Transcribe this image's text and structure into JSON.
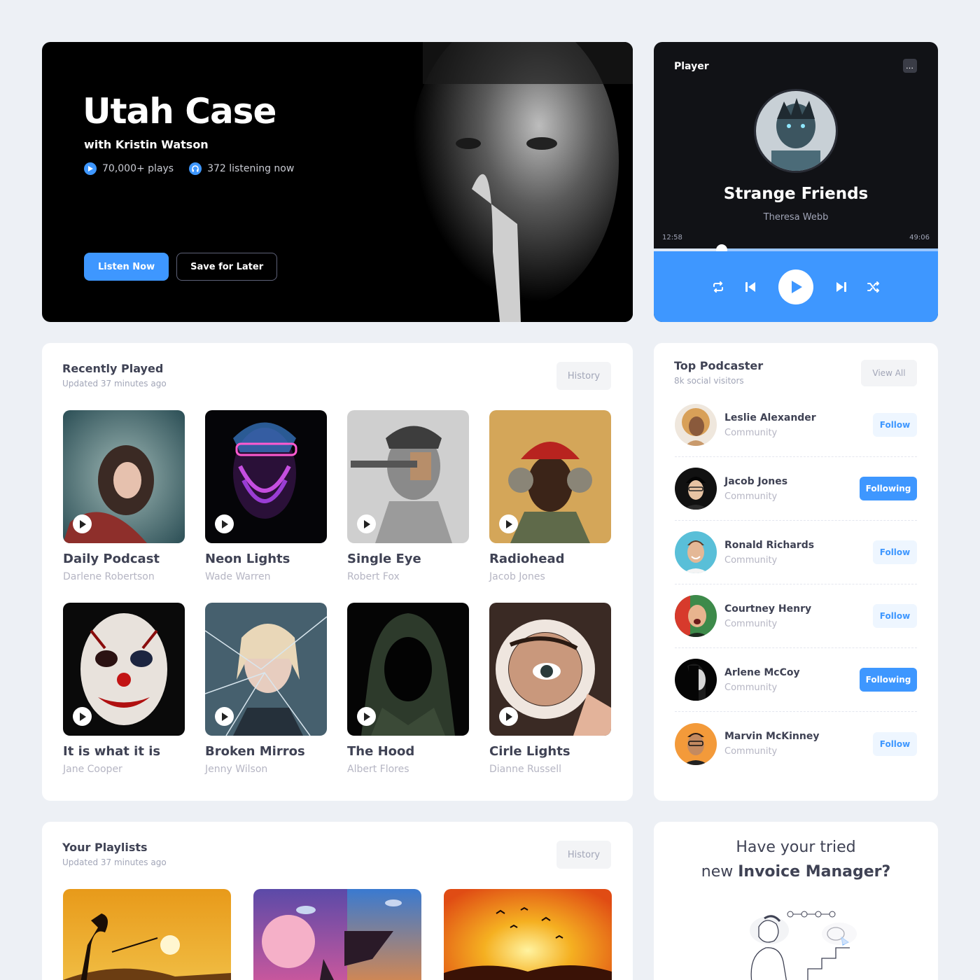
{
  "hero": {
    "title": "Utah Case",
    "subtitle": "with Kristin Watson",
    "plays": "70,000+ plays",
    "listening": "372 listening now",
    "listen_label": "Listen Now",
    "save_label": "Save for Later"
  },
  "player": {
    "label": "Player",
    "menu_icon": "…",
    "song": "Strange Friends",
    "artist": "Theresa Webb",
    "elapsed": "12:58",
    "total": "49:06",
    "progress_fraction": 0.24,
    "accent": "#3E97FF"
  },
  "recent": {
    "title": "Recently Played",
    "subtitle": "Updated 37 minutes ago",
    "history_label": "History",
    "items": [
      {
        "title": "Daily Podcast",
        "artist": "Darlene Robertson"
      },
      {
        "title": "Neon Lights",
        "artist": "Wade Warren"
      },
      {
        "title": "Single Eye",
        "artist": "Robert Fox"
      },
      {
        "title": "Radiohead",
        "artist": "Jacob Jones"
      },
      {
        "title": "It is what it is",
        "artist": "Jane Cooper"
      },
      {
        "title": "Broken Mirros",
        "artist": "Jenny Wilson"
      },
      {
        "title": "The Hood",
        "artist": "Albert Flores"
      },
      {
        "title": "Cirle Lights",
        "artist": "Dianne Russell"
      }
    ]
  },
  "top": {
    "title": "Top Podcaster",
    "subtitle": "8k social visitors",
    "viewall_label": "View All",
    "items": [
      {
        "name": "Leslie Alexander",
        "role": "Community",
        "action": "Follow",
        "following": false
      },
      {
        "name": "Jacob Jones",
        "role": "Community",
        "action": "Following",
        "following": true
      },
      {
        "name": "Ronald Richards",
        "role": "Community",
        "action": "Follow",
        "following": false
      },
      {
        "name": "Courtney Henry",
        "role": "Community",
        "action": "Follow",
        "following": false
      },
      {
        "name": "Arlene McCoy",
        "role": "Community",
        "action": "Following",
        "following": true
      },
      {
        "name": "Marvin McKinney",
        "role": "Community",
        "action": "Follow",
        "following": false
      }
    ]
  },
  "playlists": {
    "title": "Your Playlists",
    "subtitle": "Updated 37 minutes ago",
    "history_label": "History"
  },
  "promo": {
    "line1": "Have your tried",
    "line2_prefix": "new ",
    "line2_bold": "Invoice Manager?"
  }
}
